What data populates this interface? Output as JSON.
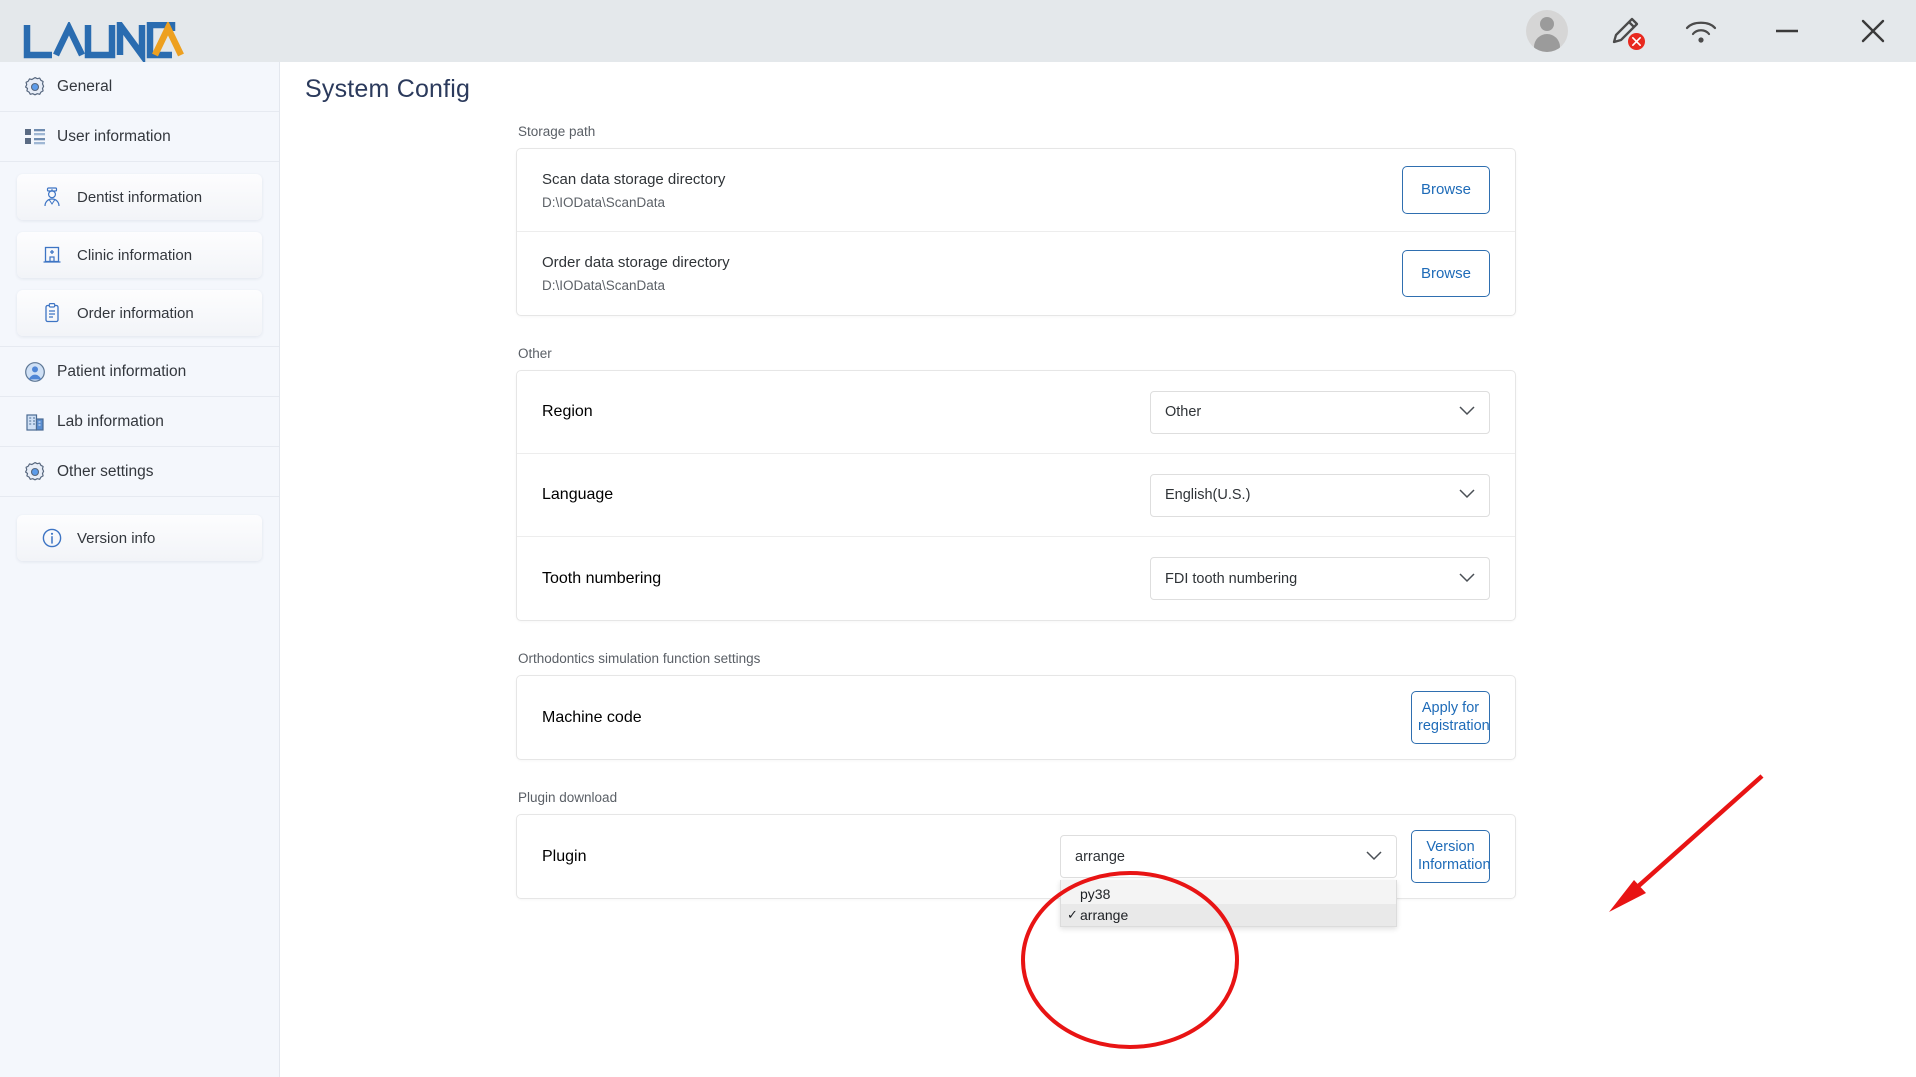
{
  "app": {
    "brand": "LAUNCA",
    "brand_colors": {
      "blue": "#2a6cb0",
      "orange": "#eda020"
    },
    "titlebar_bg": "#e4e8eb"
  },
  "titlebar": {
    "avatar_label": "user-avatar",
    "scanner_icon_label": "scanner-pen",
    "scanner_status": "disconnected",
    "wifi_icon_label": "wifi",
    "minimize_label": "Minimize",
    "close_label": "Close"
  },
  "sidebar": {
    "items": [
      {
        "label": "General",
        "icon": "gear-icon",
        "type": "top"
      },
      {
        "label": "User information",
        "icon": "list-icon",
        "type": "top"
      },
      {
        "label": "Dentist information",
        "icon": "dentist-icon",
        "type": "sub"
      },
      {
        "label": "Clinic information",
        "icon": "clinic-icon",
        "type": "sub"
      },
      {
        "label": "Order information",
        "icon": "clipboard-icon",
        "type": "sub"
      },
      {
        "label": "Patient information",
        "icon": "person-circle-icon",
        "type": "top"
      },
      {
        "label": "Lab information",
        "icon": "building-icon",
        "type": "top"
      },
      {
        "label": "Other settings",
        "icon": "gear-icon",
        "type": "top"
      },
      {
        "label": "Version info",
        "icon": "info-circle-icon",
        "type": "sub"
      }
    ]
  },
  "main": {
    "page_title": "System Config",
    "sections": {
      "storage": {
        "label": "Storage path",
        "rows": [
          {
            "title": "Scan data storage directory",
            "path": "D:\\IOData\\ScanData",
            "button": "Browse"
          },
          {
            "title": "Order data storage directory",
            "path": "D:\\IOData\\ScanData",
            "button": "Browse"
          }
        ]
      },
      "other": {
        "label": "Other",
        "rows": [
          {
            "title": "Region",
            "value": "Other"
          },
          {
            "title": "Language",
            "value": "English(U.S.)"
          },
          {
            "title": "Tooth numbering",
            "value": "FDI tooth numbering"
          }
        ]
      },
      "orthodontics": {
        "label": "Orthodontics simulation function settings",
        "row_title": "Machine code",
        "button_line1": "Apply for",
        "button_line2": "registration"
      },
      "plugin": {
        "label": "Plugin download",
        "row_title": "Plugin",
        "selected": "arrange",
        "options": [
          {
            "label": "py38",
            "checked": false
          },
          {
            "label": "arrange",
            "checked": true
          }
        ],
        "check_glyph": "✓",
        "button_line1": "Version",
        "button_line2": "Information"
      }
    }
  },
  "annotations": {
    "highlight_color": "#e81414",
    "ellipse_target": "plugin-dropdown",
    "arrow_target": "version-information-button"
  }
}
